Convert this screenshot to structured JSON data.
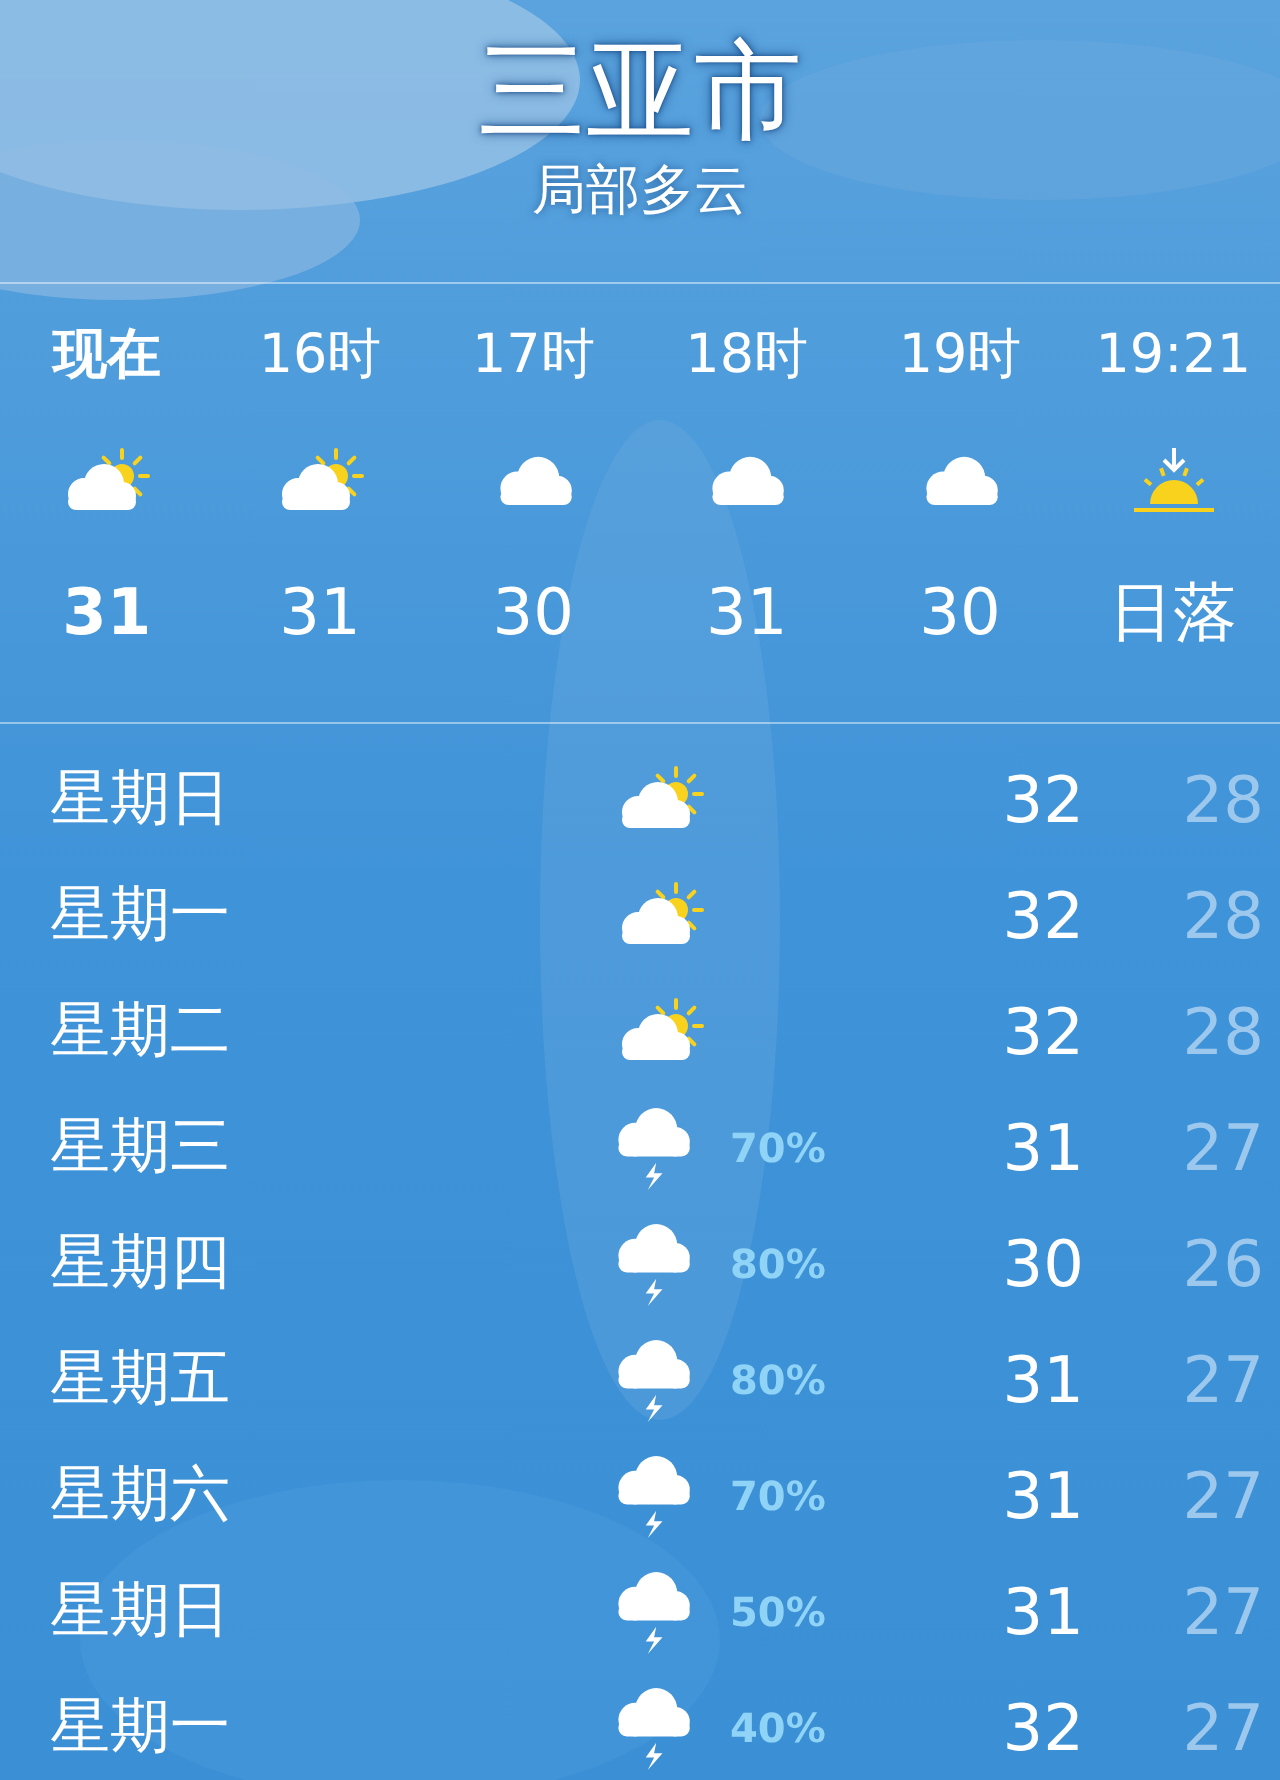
{
  "location": {
    "city": "三亚市",
    "condition": "局部多云"
  },
  "hourly": [
    {
      "time": "现在",
      "selected": true,
      "kind": "partly-sunny",
      "temp": "31"
    },
    {
      "time": "16时",
      "selected": false,
      "kind": "partly-sunny",
      "temp": "31"
    },
    {
      "time": "17时",
      "selected": false,
      "kind": "cloudy",
      "temp": "30"
    },
    {
      "time": "18时",
      "selected": false,
      "kind": "cloudy",
      "temp": "31"
    },
    {
      "time": "19时",
      "selected": false,
      "kind": "cloudy",
      "temp": "30"
    },
    {
      "time": "19:21",
      "selected": false,
      "kind": "sunset",
      "temp": "日落"
    }
  ],
  "daily": [
    {
      "day": "星期日",
      "kind": "partly-sunny",
      "high": "32",
      "low": "28"
    },
    {
      "day": "星期一",
      "kind": "partly-sunny",
      "high": "32",
      "low": "28"
    },
    {
      "day": "星期二",
      "kind": "partly-sunny",
      "high": "32",
      "low": "28"
    },
    {
      "day": "星期三",
      "kind": "thunderstorm",
      "precip": "70%",
      "high": "31",
      "low": "27"
    },
    {
      "day": "星期四",
      "kind": "thunderstorm",
      "precip": "80%",
      "high": "30",
      "low": "26"
    },
    {
      "day": "星期五",
      "kind": "thunderstorm",
      "precip": "80%",
      "high": "31",
      "low": "27"
    },
    {
      "day": "星期六",
      "kind": "thunderstorm",
      "precip": "70%",
      "high": "31",
      "low": "27"
    },
    {
      "day": "星期日",
      "kind": "thunderstorm",
      "precip": "50%",
      "high": "31",
      "low": "27"
    },
    {
      "day": "星期一",
      "kind": "thunderstorm",
      "precip": "40%",
      "high": "32",
      "low": "27"
    }
  ]
}
